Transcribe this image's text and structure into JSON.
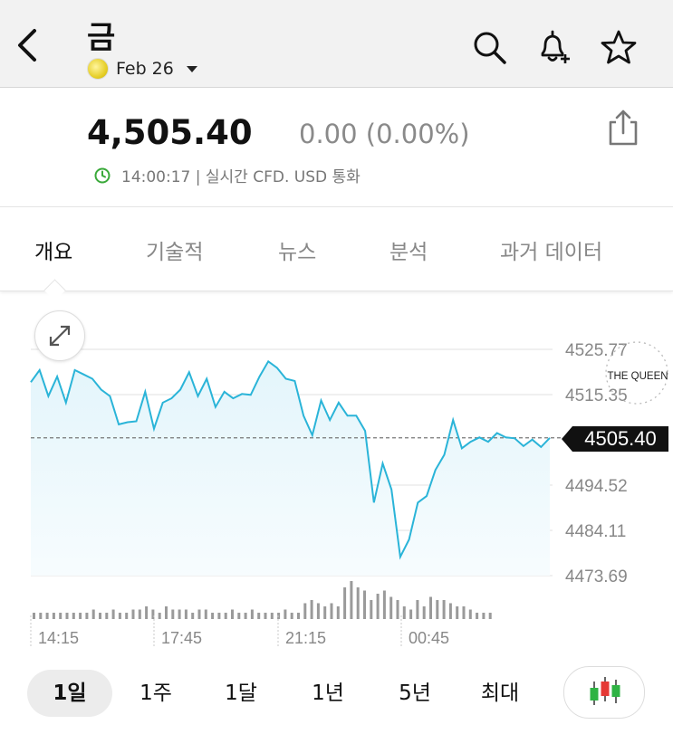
{
  "header": {
    "title": "금",
    "contract": "Feb 26"
  },
  "quote": {
    "price": "4,505.40",
    "change": "0.00 (0.00%)",
    "time_info": "14:00:17 | 실시간 CFD. USD 통화"
  },
  "tabs": [
    {
      "label": "개요",
      "active": true
    },
    {
      "label": "기술적",
      "active": false
    },
    {
      "label": "뉴스",
      "active": false
    },
    {
      "label": "분석",
      "active": false
    },
    {
      "label": "과거 데이터",
      "active": false
    }
  ],
  "watermark": "THE QUEEN",
  "chart_data": {
    "type": "area",
    "last_price_label": "4505.40",
    "y_ticks": [
      "4525.77",
      "4515.35",
      "4494.52",
      "4484.11",
      "4473.69"
    ],
    "y_tick_values": [
      4525.77,
      4515.35,
      4494.52,
      4484.11,
      4473.69
    ],
    "x_ticks": [
      "14:15",
      "17:45",
      "21:15",
      "00:45"
    ],
    "ylim": [
      4473.69,
      4525.77
    ],
    "reference_line": 4505.4,
    "values": [
      4518.2,
      4521.0,
      4515.0,
      4519.5,
      4513.5,
      4521.0,
      4520.0,
      4519.0,
      4516.5,
      4515.0,
      4508.5,
      4509.0,
      4509.2,
      4516.0,
      4507.5,
      4513.5,
      4514.5,
      4516.5,
      4520.5,
      4515.0,
      4519.0,
      4512.5,
      4516.0,
      4514.5,
      4515.5,
      4515.3,
      4519.5,
      4523.0,
      4521.5,
      4519.0,
      4518.5,
      4510.5,
      4506.0,
      4514.0,
      4509.5,
      4513.5,
      4510.5,
      4510.5,
      4507.0,
      4490.5,
      4499.5,
      4493.5,
      4478.0,
      4482.0,
      4490.5,
      4492.0,
      4498.0,
      4501.5,
      4509.5,
      4503.0,
      4504.5,
      4505.5,
      4504.5,
      4506.5,
      4505.5,
      4505.3,
      4503.5,
      4505.0,
      4503.3,
      4505.4
    ],
    "volume": [
      2,
      2,
      2,
      2,
      2,
      2,
      2,
      2,
      2,
      3,
      2,
      2,
      3,
      2,
      2,
      3,
      3,
      4,
      3,
      2,
      4,
      3,
      3,
      3,
      2,
      3,
      3,
      2,
      2,
      2,
      3,
      2,
      2,
      3,
      2,
      2,
      2,
      2,
      3,
      2,
      2,
      5,
      6,
      5,
      4,
      5,
      4,
      10,
      12,
      10,
      9,
      6,
      8,
      9,
      7,
      6,
      4,
      3,
      6,
      4,
      7,
      6,
      6,
      5,
      4,
      4,
      3,
      2,
      2,
      2
    ],
    "grid": true,
    "legend": "none"
  },
  "ranges": [
    {
      "label": "1일",
      "active": true
    },
    {
      "label": "1주",
      "active": false
    },
    {
      "label": "1달",
      "active": false
    },
    {
      "label": "1년",
      "active": false
    },
    {
      "label": "5년",
      "active": false
    },
    {
      "label": "최대",
      "active": false
    }
  ],
  "colors": {
    "line": "#2ab4d8",
    "area_top": "#e3f5fb",
    "area_bottom": "#f7fcfe",
    "price_tag": "#111111",
    "clock_green": "#3aa93a",
    "candle_green": "#2fb344",
    "candle_red": "#e53935"
  }
}
